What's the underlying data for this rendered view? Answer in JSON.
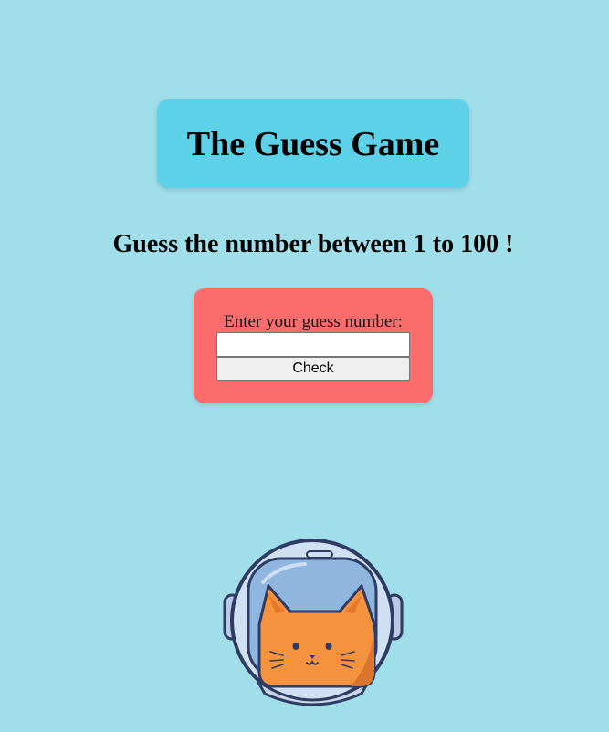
{
  "header": {
    "title": "The Guess Game"
  },
  "instructions": {
    "text": "Guess the number between 1 to 100 !"
  },
  "form": {
    "prompt_label": "Enter your guess number:",
    "guess_value": "",
    "check_label": "Check"
  },
  "illustration": {
    "icon": "cat-astronaut-icon"
  },
  "colors": {
    "background": "#a0dfea",
    "title_box": "#5cd1e8",
    "form_card": "#fd6c6c",
    "cat": "#f5923e"
  }
}
